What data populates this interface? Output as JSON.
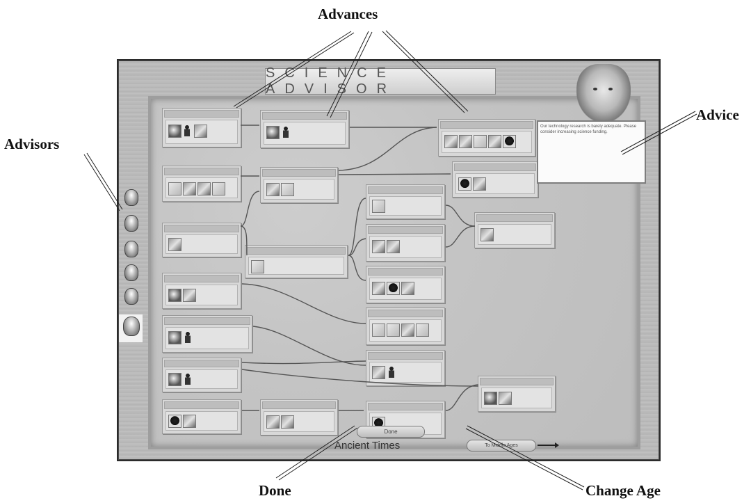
{
  "callouts": {
    "advances": "Advances",
    "advice": "Advice",
    "advisors": "Advisors",
    "done": "Done",
    "change_age": "Change Age"
  },
  "screen": {
    "title": "SCIENCE ADVISOR",
    "advice_text": "Our technology research is barely adequate. Please consider increasing science funding.",
    "done_label": "Done",
    "age_label": "Ancient Times",
    "change_age_label": "To Middle Ages"
  },
  "advisors": [
    {
      "icon": "advisor-face-icon"
    },
    {
      "icon": "advisor-face-icon"
    },
    {
      "icon": "advisor-face-icon"
    },
    {
      "icon": "advisor-face-icon"
    },
    {
      "icon": "advisor-face-icon"
    },
    {
      "icon": "advisor-face-icon",
      "selected": true
    }
  ],
  "accent_colors": {
    "board": "#c4c4c4",
    "frame": "#b7b7b7",
    "panel": "#d8d8d8"
  }
}
